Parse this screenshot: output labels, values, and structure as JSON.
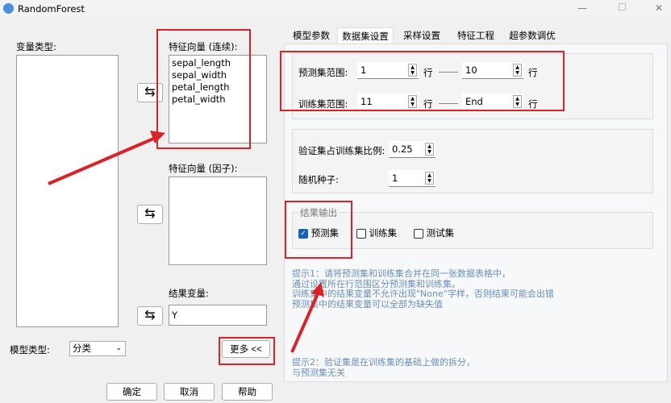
{
  "window": {
    "title": "RandomForest",
    "min": "—",
    "max": "☐",
    "close": "✕"
  },
  "left": {
    "var_type_label": "变量类型:",
    "feature_cont_label": "特征向量 (连续):",
    "feature_cont_items": [
      "sepal_length",
      "sepal_width",
      "petal_length",
      "petal_width"
    ],
    "feature_factor_label": "特征向量 (因子):",
    "result_label": "结果变量:",
    "result_value": "Y",
    "model_type_label": "模型类型:",
    "model_type_value": "分类",
    "more_button": "更多 <<",
    "swap": "⇆"
  },
  "buttons": {
    "ok": "确定",
    "cancel": "取消",
    "help": "帮助"
  },
  "tabs": [
    "模型参数",
    "数据集设置",
    "采样设置",
    "特征工程",
    "超参数调优"
  ],
  "dataset": {
    "predict_label": "预测集范围:",
    "predict_from": "1",
    "predict_to": "10",
    "train_label": "训练集范围:",
    "train_from": "11",
    "train_to": "End",
    "row": "行",
    "val_ratio_label": "验证集占训练集比例:",
    "val_ratio": "0.25",
    "seed_label": "随机种子:",
    "seed": "1",
    "output_label": "结果输出",
    "outputs": [
      {
        "label": "预测集",
        "checked": true
      },
      {
        "label": "训练集",
        "checked": false
      },
      {
        "label": "测试集",
        "checked": false
      }
    ]
  },
  "hints": {
    "h1": [
      "提示1：请将预测集和训练集合并在同一张数据表格中，",
      "通过设置所在行范围区分预测集和训练集。",
      "训练集中的结果变量不允许出现\"None\"字样，否则结果可能会出错",
      "预测集中的结果变量可以全部为缺失值"
    ],
    "h2": [
      "提示2：验证集是在训练集的基础上做的拆分，",
      "与预测集无关"
    ]
  }
}
